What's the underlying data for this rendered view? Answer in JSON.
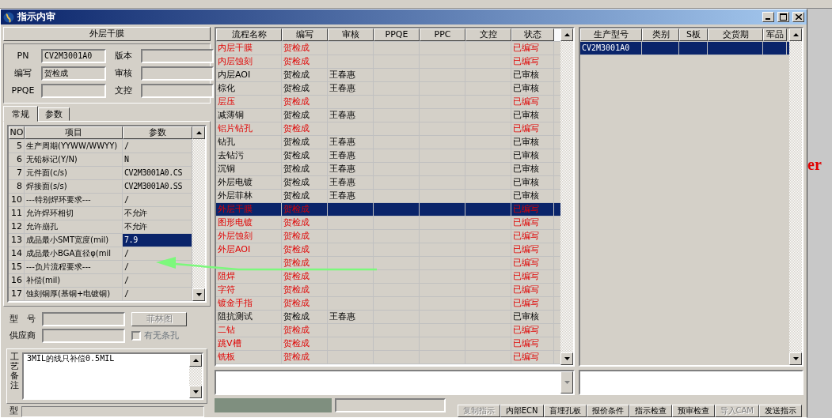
{
  "window": {
    "title": "指示内审"
  },
  "process_title": "外层干膜",
  "header_fields": [
    {
      "label": "PN",
      "value": "CV2M3001A0"
    },
    {
      "label": "版本"
    },
    {
      "label": "编写",
      "value": "贺检成"
    },
    {
      "label": "审核"
    },
    {
      "label": "PPQE"
    },
    {
      "label": "文控"
    }
  ],
  "tabs": [
    {
      "label": "常规",
      "selected": true
    },
    {
      "label": "参数",
      "selected": false
    }
  ],
  "params": {
    "columns": [
      "NO",
      "项目",
      "参数"
    ],
    "rows": [
      {
        "no": "5",
        "item": "生产周期(YYWW/WWYY)",
        "value": "/",
        "selected": false
      },
      {
        "no": "6",
        "item": "无铅标记(Y/N)",
        "value": "N",
        "selected": false
      },
      {
        "no": "7",
        "item": "元件面(c/s)",
        "value": "CV2M3001A0.CS",
        "selected": false
      },
      {
        "no": "8",
        "item": "焊接面(s/s)",
        "value": "CV2M3001A0.SS",
        "selected": false
      },
      {
        "no": "10",
        "item": "---特别焊环要求---",
        "value": "/",
        "selected": false
      },
      {
        "no": "11",
        "item": "允许焊环相切",
        "value": "不允许",
        "selected": false
      },
      {
        "no": "12",
        "item": "允许崩孔",
        "value": "不允许",
        "selected": false
      },
      {
        "no": "13",
        "item": "成品最小SMT宽度(mil)",
        "value": "7.9",
        "selected": true
      },
      {
        "no": "14",
        "item": "成品最小BGA直径φ(mil",
        "value": "/",
        "selected": false
      },
      {
        "no": "15",
        "item": "---负片流程要求---",
        "value": "/",
        "selected": false
      },
      {
        "no": "16",
        "item": "补偿(mil)",
        "value": "/",
        "selected": false
      },
      {
        "no": "17",
        "item": "蚀刻铜厚(基铜+电镀铜)",
        "value": "/",
        "selected": false
      }
    ]
  },
  "model_label": "型　号",
  "supplier_label": "供应商",
  "diagram_button": {
    "label": "菲林图",
    "disabled": true
  },
  "slot_hole": {
    "label": "有无条孔",
    "checked": false,
    "disabled": true
  },
  "remarks": {
    "label": "工艺备注",
    "text": "3MIL的线只补偿0.5MIL"
  },
  "remarks2": {
    "label": "型"
  },
  "process_table": {
    "columns": [
      "流程名称",
      "编写",
      "审核",
      "PPQE",
      "PPC",
      "文控",
      "状态"
    ],
    "rows": [
      {
        "name": "内层干膜",
        "writer": "贺检成",
        "status": "已编写",
        "approved": false,
        "selected": false
      },
      {
        "name": "内层蚀刻",
        "writer": "贺检成",
        "status": "已编写",
        "approved": false,
        "selected": false
      },
      {
        "name": "内层AOI",
        "writer": "贺检成",
        "reviewer": "王春惠",
        "status": "已审核",
        "approved": true,
        "selected": false
      },
      {
        "name": "棕化",
        "writer": "贺检成",
        "reviewer": "王春惠",
        "status": "已审核",
        "approved": true,
        "selected": false
      },
      {
        "name": "层压",
        "writer": "贺检成",
        "status": "已编写",
        "approved": false,
        "selected": false
      },
      {
        "name": "减薄铜",
        "writer": "贺检成",
        "reviewer": "王春惠",
        "status": "已审核",
        "approved": true,
        "selected": false
      },
      {
        "name": "铝片钻孔",
        "writer": "贺检成",
        "status": "已编写",
        "approved": false,
        "selected": false
      },
      {
        "name": "钻孔",
        "writer": "贺检成",
        "reviewer": "王春惠",
        "status": "已审核",
        "approved": true,
        "selected": false
      },
      {
        "name": "去钻污",
        "writer": "贺检成",
        "reviewer": "王春惠",
        "status": "已审核",
        "approved": true,
        "selected": false
      },
      {
        "name": "沉铜",
        "writer": "贺检成",
        "reviewer": "王春惠",
        "status": "已审核",
        "approved": true,
        "selected": false
      },
      {
        "name": "外层电镀",
        "writer": "贺检成",
        "reviewer": "王春惠",
        "status": "已审核",
        "approved": true,
        "selected": false
      },
      {
        "name": "外层菲林",
        "writer": "贺检成",
        "reviewer": "王春惠",
        "status": "已审核",
        "approved": true,
        "selected": false
      },
      {
        "name": "外层干膜",
        "writer": "贺检成",
        "status": "已编写",
        "approved": false,
        "selected": true
      },
      {
        "name": "图形电镀",
        "writer": "贺检成",
        "status": "已编写",
        "approved": false,
        "selected": false
      },
      {
        "name": "外层蚀刻",
        "writer": "贺检成",
        "status": "已编写",
        "approved": false,
        "selected": false
      },
      {
        "name": "外层AOI",
        "writer": "贺检成",
        "status": "已编写",
        "approved": false,
        "selected": false
      },
      {
        "writer": "贺检成",
        "status": "已编写",
        "approved": false,
        "selected": false
      },
      {
        "name": "阻焊",
        "writer": "贺检成",
        "status": "已编写",
        "approved": false,
        "selected": false
      },
      {
        "name": "字符",
        "writer": "贺检成",
        "status": "已编写",
        "approved": false,
        "selected": false
      },
      {
        "name": "镀金手指",
        "writer": "贺检成",
        "status": "已编写",
        "approved": false,
        "selected": false
      },
      {
        "name": "阻抗测试",
        "writer": "贺检成",
        "reviewer": "王春惠",
        "status": "已审核",
        "approved": true,
        "selected": false
      },
      {
        "name": "二钻",
        "writer": "贺检成",
        "status": "已编写",
        "approved": false,
        "selected": false
      },
      {
        "name": "跳V槽",
        "writer": "贺检成",
        "status": "已编写",
        "approved": false,
        "selected": false
      },
      {
        "name": "铣板",
        "writer": "贺检成",
        "status": "已编写",
        "approved": false,
        "selected": false
      }
    ]
  },
  "orders": {
    "columns": [
      "生产型号",
      "类别",
      "S板",
      "交货期",
      "军品"
    ],
    "rows": [
      {
        "model": "CV2M3001A0",
        "selected": true
      }
    ]
  },
  "actions": [
    {
      "label": "复制指示",
      "disabled": true
    },
    {
      "label": "内部ECN",
      "disabled": false
    },
    {
      "label": "盲埋孔板",
      "disabled": false
    },
    {
      "label": "报价条件",
      "disabled": false
    },
    {
      "label": "指示检查",
      "disabled": false
    },
    {
      "label": "预审检查",
      "disabled": false
    },
    {
      "label": "导入CAM",
      "disabled": true
    },
    {
      "label": "发送指示",
      "disabled": false
    }
  ],
  "backdrop_text": "er"
}
